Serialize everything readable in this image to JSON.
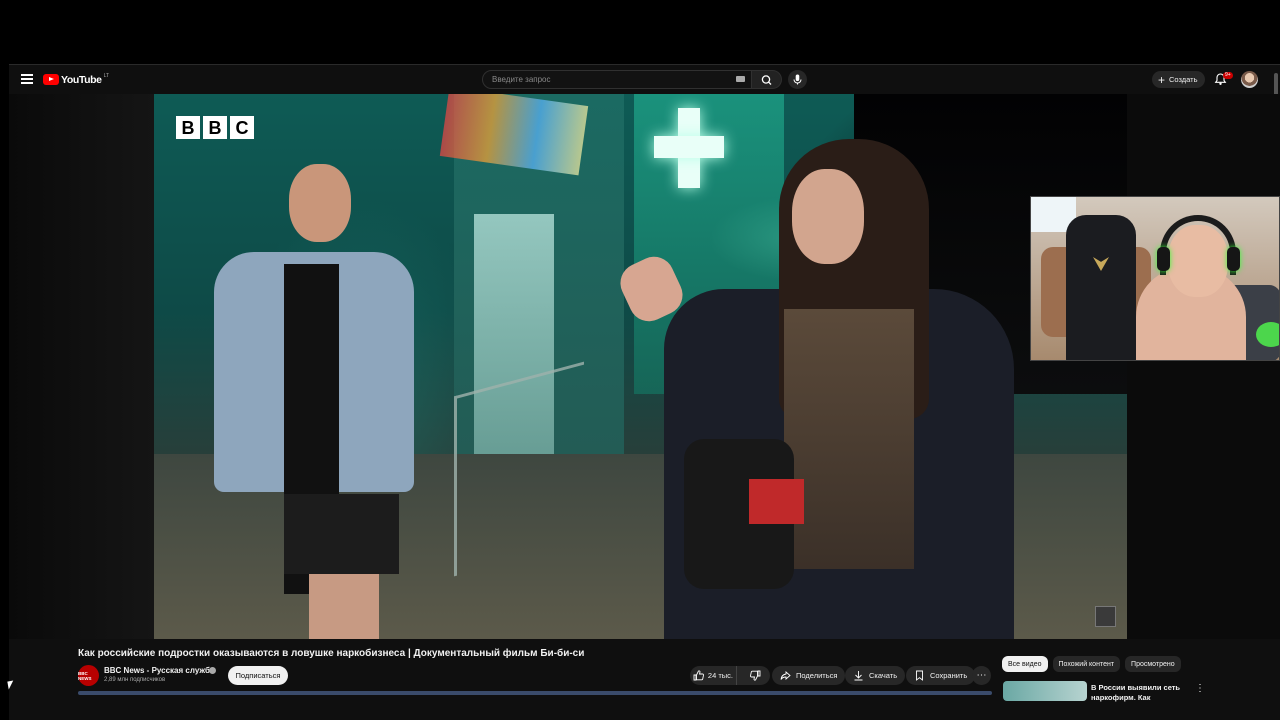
{
  "header": {
    "logo_text": "YouTube",
    "logo_region": "LT",
    "search_placeholder": "Введите запрос",
    "create_label": "Создать",
    "notification_count": "9+"
  },
  "video": {
    "channel_logo_letters": [
      "B",
      "B",
      "C"
    ],
    "title": "Как российские подростки оказываются в ловушке наркобизнеса | Документальный фильм Би-би-си"
  },
  "channel": {
    "avatar_text": "BBC NEWS",
    "name": "BBC News - Русская служба",
    "subscribers": "2,89 млн подписчиков",
    "subscribe_label": "Подписаться"
  },
  "actions": {
    "likes": "24 тыс.",
    "share_label": "Поделиться",
    "download_label": "Скачать",
    "save_label": "Сохранить"
  },
  "sidebar": {
    "tabs": [
      {
        "label": "Все видео",
        "active": true
      },
      {
        "label": "Похожий контент",
        "active": false
      },
      {
        "label": "Просмотрено",
        "active": false
      }
    ],
    "recommendation": {
      "title": "В России выявили сеть наркофирм. Как вовлекают"
    }
  },
  "icons": {
    "menu": "menu-icon",
    "search": "search-icon",
    "mic": "mic-icon",
    "bell": "bell-icon",
    "like": "thumbs-up-icon",
    "dislike": "thumbs-down-icon",
    "share": "share-icon",
    "download": "download-icon",
    "save": "bookmark-icon",
    "more": "more-horizontal-icon"
  },
  "colors": {
    "brand_red": "#ff0000",
    "background": "#0f0f0f",
    "pill_bg": "#272727"
  }
}
